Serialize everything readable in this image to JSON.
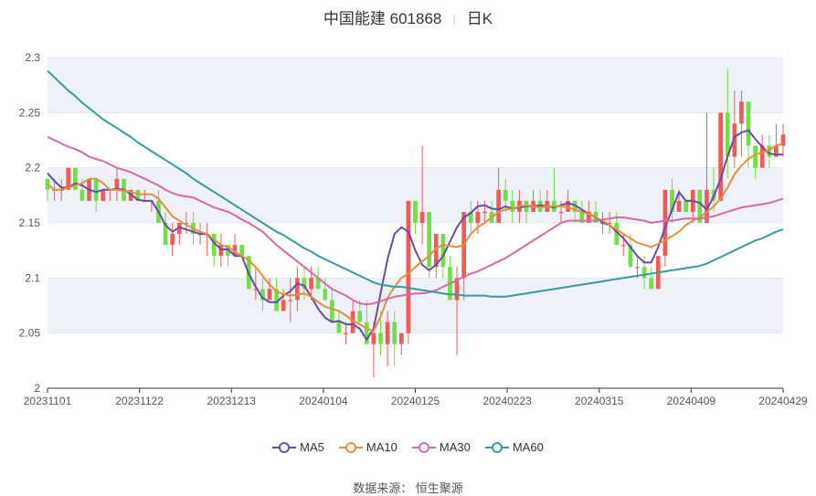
{
  "title": {
    "name": "中国能建 601868",
    "period": "日K"
  },
  "source_text": "数据来源： 恒生聚源",
  "colors": {
    "up": "#f25a5a",
    "down": "#6fe04a",
    "MA5": "#6a4ca5",
    "MA10": "#e0913a",
    "MA30": "#d56aa8",
    "MA60": "#3a9a9c",
    "grid_band": "#eef1f7"
  },
  "chart_data": {
    "type": "candlestick",
    "ylim": [
      2.0,
      2.3
    ],
    "y_ticks": [
      "2",
      "2.05",
      "2.1",
      "2.15",
      "2.2",
      "2.25",
      "2.3"
    ],
    "x_tick_labels": [
      "20231101",
      "20231122",
      "20231213",
      "20240104",
      "20240125",
      "20240223",
      "20240315",
      "20240409",
      "20240429"
    ],
    "legend": [
      "MA5",
      "MA10",
      "MA30",
      "MA60"
    ],
    "ohlc": [
      [
        2.19,
        2.19,
        2.17,
        2.18
      ],
      [
        2.18,
        2.19,
        2.17,
        2.18
      ],
      [
        2.18,
        2.19,
        2.17,
        2.18
      ],
      [
        2.18,
        2.2,
        2.18,
        2.2
      ],
      [
        2.2,
        2.2,
        2.18,
        2.18
      ],
      [
        2.18,
        2.19,
        2.17,
        2.17
      ],
      [
        2.17,
        2.19,
        2.17,
        2.19
      ],
      [
        2.19,
        2.19,
        2.16,
        2.17
      ],
      [
        2.17,
        2.18,
        2.17,
        2.18
      ],
      [
        2.18,
        2.18,
        2.17,
        2.18
      ],
      [
        2.18,
        2.2,
        2.17,
        2.19
      ],
      [
        2.19,
        2.19,
        2.17,
        2.17
      ],
      [
        2.17,
        2.18,
        2.17,
        2.18
      ],
      [
        2.18,
        2.18,
        2.17,
        2.17
      ],
      [
        2.17,
        2.18,
        2.17,
        2.17
      ],
      [
        2.17,
        2.17,
        2.16,
        2.17
      ],
      [
        2.17,
        2.18,
        2.15,
        2.15
      ],
      [
        2.15,
        2.16,
        2.13,
        2.13
      ],
      [
        2.13,
        2.15,
        2.12,
        2.14
      ],
      [
        2.14,
        2.15,
        2.13,
        2.15
      ],
      [
        2.15,
        2.16,
        2.14,
        2.15
      ],
      [
        2.15,
        2.16,
        2.13,
        2.14
      ],
      [
        2.14,
        2.15,
        2.13,
        2.14
      ],
      [
        2.14,
        2.15,
        2.12,
        2.14
      ],
      [
        2.14,
        2.14,
        2.11,
        2.12
      ],
      [
        2.12,
        2.14,
        2.11,
        2.13
      ],
      [
        2.13,
        2.13,
        2.11,
        2.12
      ],
      [
        2.12,
        2.14,
        2.12,
        2.13
      ],
      [
        2.13,
        2.13,
        2.12,
        2.12
      ],
      [
        2.12,
        2.12,
        2.09,
        2.09
      ],
      [
        2.09,
        2.11,
        2.08,
        2.09
      ],
      [
        2.09,
        2.1,
        2.07,
        2.08
      ],
      [
        2.08,
        2.1,
        2.08,
        2.09
      ],
      [
        2.09,
        2.1,
        2.07,
        2.07
      ],
      [
        2.07,
        2.09,
        2.07,
        2.08
      ],
      [
        2.08,
        2.1,
        2.06,
        2.08
      ],
      [
        2.08,
        2.11,
        2.07,
        2.1
      ],
      [
        2.1,
        2.11,
        2.08,
        2.09
      ],
      [
        2.09,
        2.11,
        2.08,
        2.1
      ],
      [
        2.1,
        2.11,
        2.09,
        2.09
      ],
      [
        2.09,
        2.1,
        2.08,
        2.08
      ],
      [
        2.08,
        2.09,
        2.06,
        2.06
      ],
      [
        2.06,
        2.07,
        2.05,
        2.05
      ],
      [
        2.05,
        2.06,
        2.04,
        2.05
      ],
      [
        2.05,
        2.08,
        2.05,
        2.07
      ],
      [
        2.07,
        2.08,
        2.06,
        2.06
      ],
      [
        2.06,
        2.08,
        2.04,
        2.04
      ],
      [
        2.04,
        2.06,
        2.01,
        2.05
      ],
      [
        2.05,
        2.07,
        2.03,
        2.04
      ],
      [
        2.04,
        2.07,
        2.02,
        2.06
      ],
      [
        2.06,
        2.07,
        2.02,
        2.04
      ],
      [
        2.04,
        2.05,
        2.03,
        2.05
      ],
      [
        2.05,
        2.17,
        2.04,
        2.17
      ],
      [
        2.17,
        2.17,
        2.14,
        2.15
      ],
      [
        2.15,
        2.22,
        2.13,
        2.16
      ],
      [
        2.16,
        2.16,
        2.1,
        2.11
      ],
      [
        2.11,
        2.14,
        2.1,
        2.14
      ],
      [
        2.14,
        2.14,
        2.1,
        2.11
      ],
      [
        2.11,
        2.12,
        2.08,
        2.08
      ],
      [
        2.08,
        2.11,
        2.03,
        2.1
      ],
      [
        2.1,
        2.16,
        2.08,
        2.16
      ],
      [
        2.16,
        2.17,
        2.14,
        2.15
      ],
      [
        2.15,
        2.17,
        2.14,
        2.16
      ],
      [
        2.16,
        2.17,
        2.15,
        2.16
      ],
      [
        2.16,
        2.17,
        2.15,
        2.15
      ],
      [
        2.15,
        2.2,
        2.15,
        2.18
      ],
      [
        2.18,
        2.19,
        2.16,
        2.17
      ],
      [
        2.17,
        2.18,
        2.15,
        2.16
      ],
      [
        2.16,
        2.18,
        2.15,
        2.17
      ],
      [
        2.17,
        2.17,
        2.15,
        2.16
      ],
      [
        2.16,
        2.18,
        2.16,
        2.17
      ],
      [
        2.17,
        2.18,
        2.16,
        2.16
      ],
      [
        2.16,
        2.18,
        2.16,
        2.17
      ],
      [
        2.17,
        2.2,
        2.16,
        2.16
      ],
      [
        2.16,
        2.17,
        2.15,
        2.16
      ],
      [
        2.16,
        2.18,
        2.16,
        2.17
      ],
      [
        2.17,
        2.17,
        2.15,
        2.16
      ],
      [
        2.16,
        2.17,
        2.15,
        2.15
      ],
      [
        2.15,
        2.17,
        2.15,
        2.16
      ],
      [
        2.16,
        2.17,
        2.15,
        2.15
      ],
      [
        2.15,
        2.16,
        2.14,
        2.15
      ],
      [
        2.15,
        2.16,
        2.14,
        2.15
      ],
      [
        2.15,
        2.16,
        2.13,
        2.13
      ],
      [
        2.13,
        2.14,
        2.12,
        2.13
      ],
      [
        2.13,
        2.14,
        2.11,
        2.11
      ],
      [
        2.11,
        2.12,
        2.1,
        2.11
      ],
      [
        2.11,
        2.12,
        2.09,
        2.1
      ],
      [
        2.1,
        2.11,
        2.09,
        2.09
      ],
      [
        2.09,
        2.12,
        2.09,
        2.12
      ],
      [
        2.12,
        2.18,
        2.11,
        2.18
      ],
      [
        2.18,
        2.19,
        2.15,
        2.16
      ],
      [
        2.16,
        2.18,
        2.16,
        2.17
      ],
      [
        2.17,
        2.17,
        2.16,
        2.16
      ],
      [
        2.16,
        2.18,
        2.15,
        2.18
      ],
      [
        2.18,
        2.18,
        2.15,
        2.15
      ],
      [
        2.15,
        2.25,
        2.15,
        2.18
      ],
      [
        2.18,
        2.2,
        2.16,
        2.17
      ],
      [
        2.17,
        2.25,
        2.17,
        2.25
      ],
      [
        2.25,
        2.29,
        2.19,
        2.21
      ],
      [
        2.21,
        2.27,
        2.2,
        2.24
      ],
      [
        2.24,
        2.27,
        2.21,
        2.26
      ],
      [
        2.26,
        2.26,
        2.2,
        2.22
      ],
      [
        2.22,
        2.22,
        2.19,
        2.2
      ],
      [
        2.2,
        2.23,
        2.2,
        2.22
      ],
      [
        2.22,
        2.23,
        2.2,
        2.21
      ],
      [
        2.21,
        2.24,
        2.21,
        2.22
      ],
      [
        2.22,
        2.24,
        2.21,
        2.23
      ]
    ],
    "series": [
      {
        "name": "MA5",
        "y": [
          2.195,
          2.188,
          2.182,
          2.182,
          2.186,
          2.184,
          2.18,
          2.178,
          2.18,
          2.18,
          2.181,
          2.18,
          2.176,
          2.171,
          2.17,
          2.17,
          2.16,
          2.148,
          2.142,
          2.146,
          2.144,
          2.142,
          2.14,
          2.14,
          2.132,
          2.126,
          2.126,
          2.12,
          2.12,
          2.104,
          2.092,
          2.082,
          2.078,
          2.078,
          2.084,
          2.088,
          2.095,
          2.093,
          2.083,
          2.072,
          2.064,
          2.06,
          2.061,
          2.058,
          2.058,
          2.054,
          2.044,
          2.054,
          2.086,
          2.117,
          2.14,
          2.146,
          2.142,
          2.125,
          2.112,
          2.107,
          2.112,
          2.12,
          2.133,
          2.146,
          2.155,
          2.159,
          2.165,
          2.166,
          2.163,
          2.162,
          2.165,
          2.163,
          2.164,
          2.165,
          2.165,
          2.166,
          2.165,
          2.164,
          2.166,
          2.168,
          2.166,
          2.162,
          2.158,
          2.155,
          2.15,
          2.148,
          2.142,
          2.136,
          2.128,
          2.12,
          2.114,
          2.114,
          2.128,
          2.146,
          2.162,
          2.178,
          2.17,
          2.17,
          2.168,
          2.162,
          2.174,
          2.19,
          2.21,
          2.228,
          2.232,
          2.234,
          2.226,
          2.219,
          2.213,
          2.212,
          2.212
        ]
      },
      {
        "name": "MA10",
        "y": [
          2.185,
          2.18,
          2.18,
          2.182,
          2.184,
          2.186,
          2.19,
          2.19,
          2.186,
          2.18,
          2.18,
          2.179,
          2.178,
          2.176,
          2.176,
          2.176,
          2.172,
          2.164,
          2.156,
          2.152,
          2.148,
          2.145,
          2.142,
          2.14,
          2.135,
          2.13,
          2.128,
          2.124,
          2.12,
          2.116,
          2.11,
          2.102,
          2.094,
          2.088,
          2.085,
          2.084,
          2.085,
          2.086,
          2.083,
          2.078,
          2.074,
          2.072,
          2.07,
          2.066,
          2.061,
          2.058,
          2.054,
          2.052,
          2.065,
          2.082,
          2.092,
          2.1,
          2.104,
          2.11,
          2.115,
          2.12,
          2.127,
          2.13,
          2.129,
          2.128,
          2.13,
          2.14,
          2.146,
          2.15,
          2.155,
          2.16,
          2.162,
          2.163,
          2.165,
          2.166,
          2.165,
          2.164,
          2.165,
          2.165,
          2.165,
          2.164,
          2.162,
          2.16,
          2.158,
          2.155,
          2.152,
          2.148,
          2.144,
          2.14,
          2.136,
          2.132,
          2.13,
          2.128,
          2.131,
          2.134,
          2.138,
          2.142,
          2.148,
          2.152,
          2.155,
          2.16,
          2.165,
          2.172,
          2.182,
          2.194,
          2.202,
          2.208,
          2.212,
          2.214,
          2.216,
          2.22,
          2.222
        ]
      },
      {
        "name": "MA30",
        "y": [
          2.228,
          2.225,
          2.222,
          2.219,
          2.217,
          2.214,
          2.21,
          2.208,
          2.206,
          2.203,
          2.2,
          2.198,
          2.196,
          2.193,
          2.19,
          2.187,
          2.184,
          2.18,
          2.177,
          2.175,
          2.174,
          2.173,
          2.17,
          2.167,
          2.164,
          2.162,
          2.16,
          2.157,
          2.153,
          2.15,
          2.146,
          2.142,
          2.136,
          2.13,
          2.125,
          2.12,
          2.115,
          2.11,
          2.105,
          2.1,
          2.095,
          2.09,
          2.087,
          2.084,
          2.08,
          2.077,
          2.076,
          2.077,
          2.079,
          2.081,
          2.083,
          2.084,
          2.085,
          2.086,
          2.086,
          2.087,
          2.089,
          2.092,
          2.095,
          2.098,
          2.101,
          2.104,
          2.106,
          2.109,
          2.112,
          2.115,
          2.118,
          2.122,
          2.126,
          2.13,
          2.134,
          2.138,
          2.142,
          2.146,
          2.15,
          2.152,
          2.152,
          2.152,
          2.152,
          2.152,
          2.153,
          2.154,
          2.155,
          2.155,
          2.154,
          2.153,
          2.152,
          2.15,
          2.151,
          2.152,
          2.152,
          2.153,
          2.154,
          2.154,
          2.154,
          2.155,
          2.156,
          2.158,
          2.16,
          2.162,
          2.164,
          2.165,
          2.166,
          2.167,
          2.168,
          2.17,
          2.172
        ]
      },
      {
        "name": "MA60",
        "y": [
          2.288,
          2.282,
          2.276,
          2.27,
          2.265,
          2.259,
          2.254,
          2.249,
          2.244,
          2.24,
          2.236,
          2.232,
          2.228,
          2.223,
          2.219,
          2.215,
          2.211,
          2.207,
          2.203,
          2.199,
          2.195,
          2.19,
          2.186,
          2.182,
          2.178,
          2.174,
          2.17,
          2.166,
          2.162,
          2.158,
          2.154,
          2.15,
          2.146,
          2.142,
          2.139,
          2.135,
          2.131,
          2.127,
          2.124,
          2.12,
          2.117,
          2.114,
          2.111,
          2.108,
          2.105,
          2.102,
          2.099,
          2.096,
          2.094,
          2.093,
          2.092,
          2.092,
          2.091,
          2.09,
          2.089,
          2.088,
          2.087,
          2.086,
          2.085,
          2.085,
          2.084,
          2.084,
          2.084,
          2.084,
          2.083,
          2.083,
          2.083,
          2.084,
          2.085,
          2.086,
          2.087,
          2.088,
          2.089,
          2.09,
          2.091,
          2.092,
          2.093,
          2.094,
          2.095,
          2.096,
          2.097,
          2.098,
          2.099,
          2.1,
          2.101,
          2.102,
          2.103,
          2.104,
          2.105,
          2.106,
          2.107,
          2.108,
          2.109,
          2.11,
          2.111,
          2.113,
          2.116,
          2.119,
          2.122,
          2.125,
          2.128,
          2.131,
          2.134,
          2.136,
          2.139,
          2.142,
          2.144
        ]
      }
    ]
  }
}
